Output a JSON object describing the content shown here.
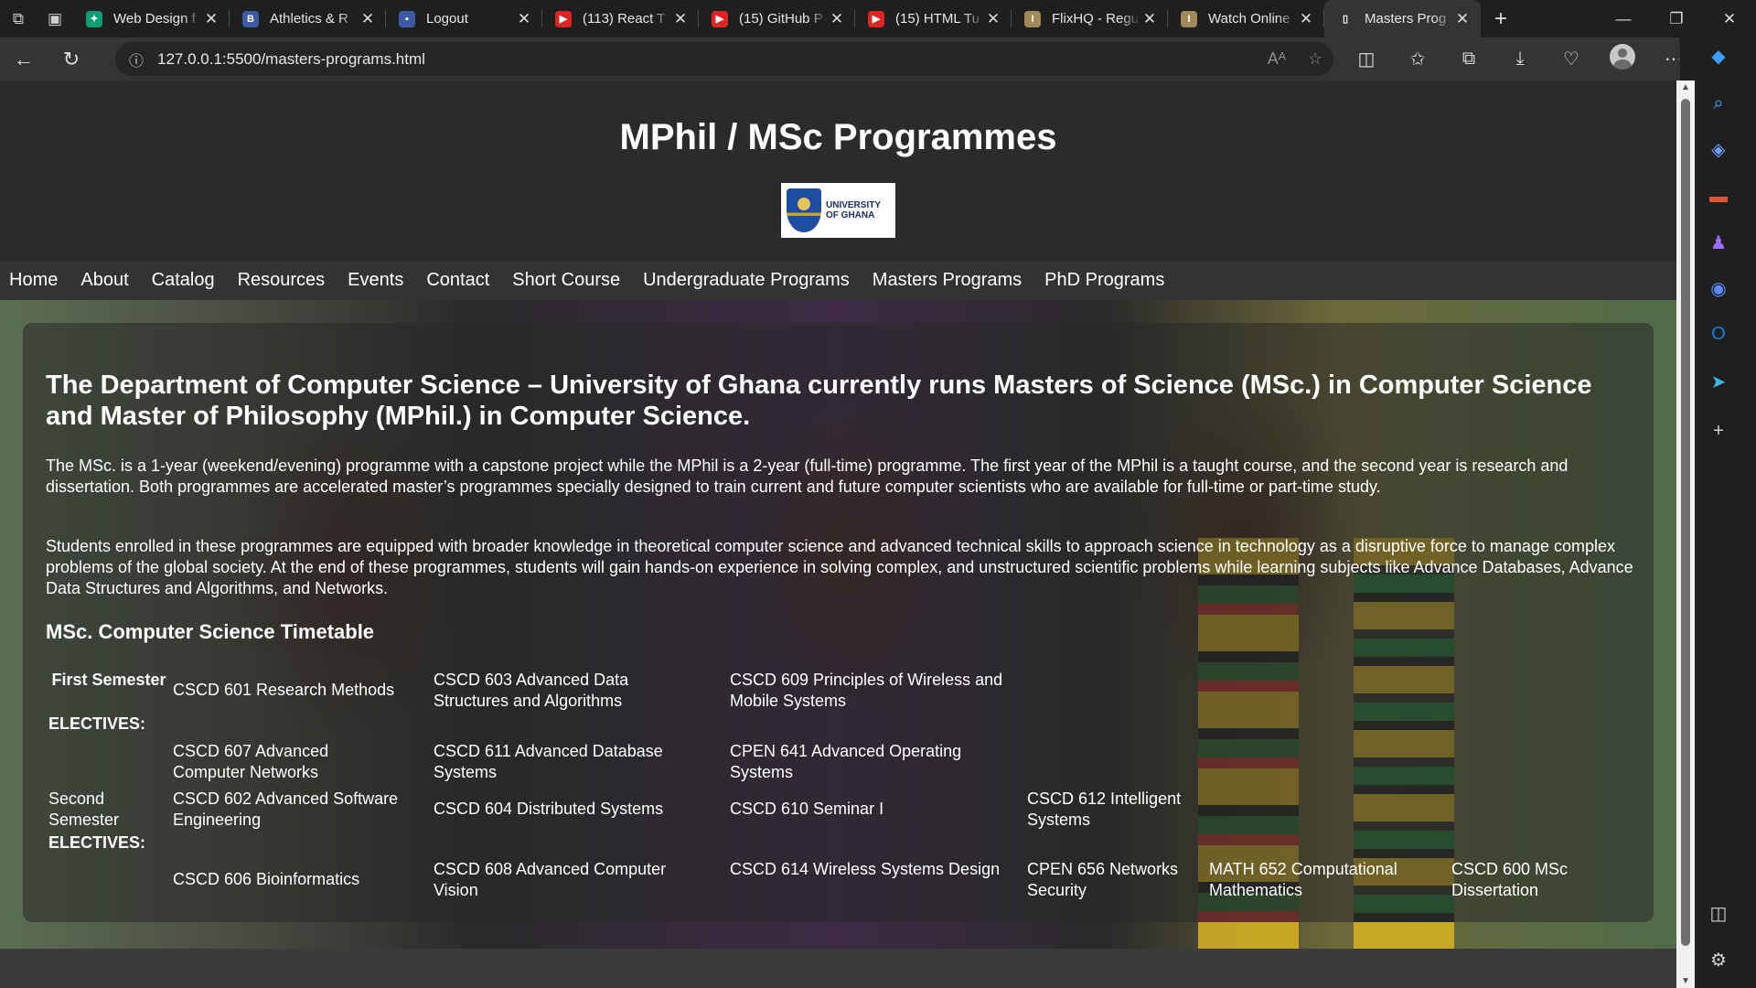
{
  "browser": {
    "tabs": [
      {
        "title": "Web Design f",
        "favicon": "chatgpt-icon",
        "color": "#0f9d75",
        "glyph": "✦"
      },
      {
        "title": "Athletics & R",
        "favicon": "bootstrap-icon",
        "color": "#3b5ba5",
        "glyph": "B"
      },
      {
        "title": "Logout",
        "favicon": "site-icon",
        "color": "#3b5ba5",
        "glyph": "▪"
      },
      {
        "title": "(113) React T",
        "favicon": "youtube-icon",
        "color": "#e02424",
        "glyph": "▶"
      },
      {
        "title": "(15) GitHub P",
        "favicon": "youtube-icon",
        "color": "#e02424",
        "glyph": "▶"
      },
      {
        "title": "(15) HTML Tu",
        "favicon": "youtube-icon",
        "color": "#e02424",
        "glyph": "▶"
      },
      {
        "title": "FlixHQ - Regu",
        "favicon": "flixhq-icon",
        "color": "#a08a5a",
        "glyph": "I"
      },
      {
        "title": "Watch Online",
        "favicon": "flixhq-icon",
        "color": "#a08a5a",
        "glyph": "I"
      },
      {
        "title": "Masters Prog",
        "favicon": "page-icon",
        "color": "#333435",
        "glyph": "▯",
        "active": true
      }
    ],
    "url": "127.0.0.1:5500/masters-programs.html"
  },
  "site": {
    "title": "MPhil / MSc Programmes",
    "logo_text_line1": "UNIVERSITY",
    "logo_text_line2": "OF GHANA",
    "nav": [
      "Home",
      "About",
      "Catalog",
      "Resources",
      "Events",
      "Contact",
      "Short Course",
      "Undergraduate Programs",
      "Masters Programs",
      "PhD Programs"
    ]
  },
  "content": {
    "heading": "The Department of Computer Science – University of Ghana currently runs Masters of Science (MSc.) in Computer Science and Master of Philosophy (MPhil.) in Computer Science.",
    "paragraph1": "The MSc. is a 1-year (weekend/evening) programme with a capstone project while the MPhil is a 2-year (full-time) programme. The first year of the MPhil is a taught course, and the second year is research and dissertation. Both programmes are accelerated master’s programmes specially designed to train current and future computer scientists who are available for full-time or part-time study.",
    "paragraph2": "Students enrolled in these programmes are equipped with broader knowledge in theoretical computer science and advanced technical skills to approach science in technology as a disruptive force to manage complex problems of the global society. At the end of these programmes, students will gain hands-on experience in solving complex, and unstructured scientific problems while learning subjects like Advance Databases, Advance Data Structures and Algorithms, and Networks.",
    "timetable_heading": "MSc. Computer Science Timetable",
    "timetable": {
      "first_semester_label": "First Semester",
      "electives_label": "ELECTIVES:",
      "second_semester_label": "Second Semester",
      "first_core": [
        "CSCD 601 Research Methods",
        "CSCD 603 Advanced Data Structures and Algorithms",
        "CSCD 609 Principles of Wireless and Mobile Systems"
      ],
      "first_electives": [
        "CSCD 607 Advanced Computer Networks",
        "CSCD 611 Advanced Database Systems",
        "CPEN 641 Advanced Operating Systems"
      ],
      "second_core": [
        "CSCD 602 Advanced Software Engineering",
        "CSCD 604 Distributed Systems",
        "CSCD 610 Seminar I",
        "CSCD 612 Intelligent Systems"
      ],
      "second_electives": [
        "CSCD 606 Bioinformatics",
        "CSCD 608 Advanced Computer Vision",
        "CSCD 614 Wireless Systems Design",
        "CPEN 656 Networks Security",
        "MATH 652 Computational Mathematics",
        "CSCD 600 MSc Dissertation"
      ]
    }
  }
}
